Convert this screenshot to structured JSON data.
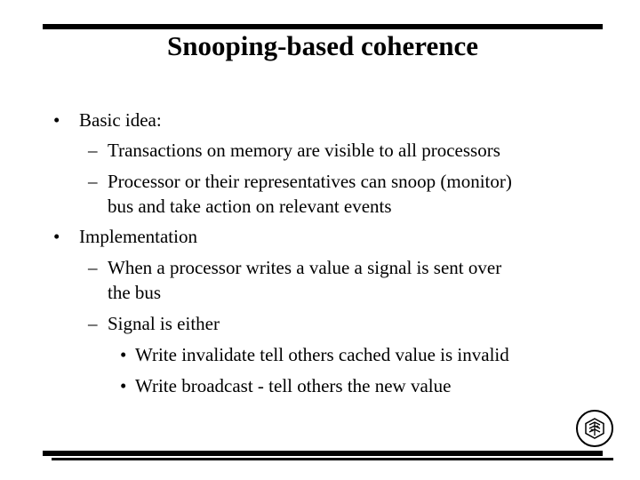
{
  "slide": {
    "title": "Snooping-based coherence",
    "bullets": [
      {
        "marker": "•",
        "text": "Basic idea:",
        "children": [
          {
            "marker": "–",
            "lines": [
              "Transactions on memory are visible to all processors"
            ]
          },
          {
            "marker": "–",
            "lines": [
              "Processor or their representatives can snoop (monitor)",
              "bus and take action on relevant events"
            ]
          }
        ]
      },
      {
        "marker": "•",
        "text": "Implementation",
        "children": [
          {
            "marker": "–",
            "lines": [
              "When a processor writes a value a signal is sent over",
              "the bus"
            ]
          },
          {
            "marker": "–",
            "lines": [
              "Signal is either"
            ],
            "children": [
              {
                "marker": "•",
                "text": "Write invalidate tell others cached value is invalid"
              },
              {
                "marker": "•",
                "text": "Write broadcast - tell others the new value"
              }
            ]
          }
        ]
      }
    ],
    "logo_icon": "university-seal-icon"
  }
}
